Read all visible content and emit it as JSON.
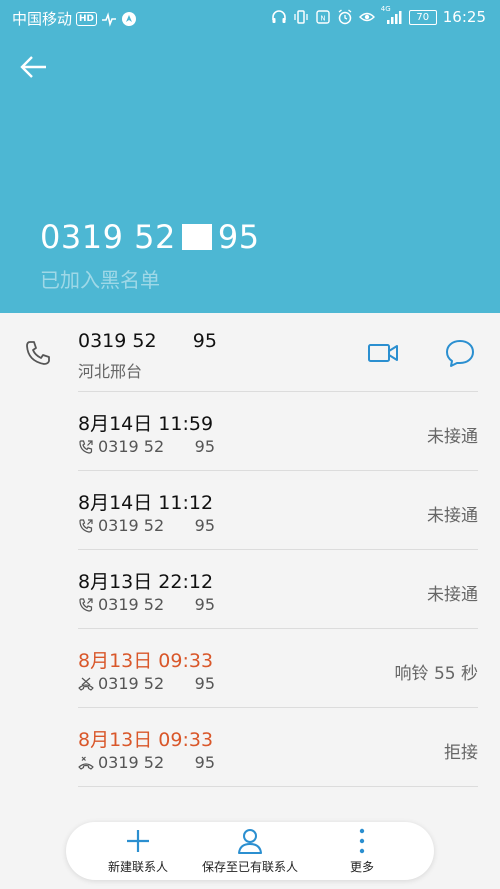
{
  "status_bar": {
    "carrier": "中国移动",
    "hd_badge": "HD",
    "network_4g": "4G",
    "battery": "70",
    "time": "16:25"
  },
  "header": {
    "number_part1": "0319 52",
    "number_part2": "95",
    "blacklist_label": "已加入黑名单"
  },
  "contact": {
    "number": "0319 52      95",
    "location": "河北邢台"
  },
  "call_log": [
    {
      "date": "8月14日 11:59",
      "number": "0319 52      95",
      "status": "未接通",
      "missed": false,
      "icon": "outgoing-call-icon"
    },
    {
      "date": "8月14日 11:12",
      "number": "0319 52      95",
      "status": "未接通",
      "missed": false,
      "icon": "outgoing-call-icon"
    },
    {
      "date": "8月13日 22:12",
      "number": "0319 52      95",
      "status": "未接通",
      "missed": false,
      "icon": "outgoing-call-icon"
    },
    {
      "date": "8月13日 09:33",
      "number": "0319 52      95",
      "status": "响铃 55 秒",
      "missed": true,
      "icon": "blocked-call-icon"
    },
    {
      "date": "8月13日 09:33",
      "number": "0319 52      95",
      "status": "拒接",
      "missed": true,
      "icon": "rejected-call-icon"
    }
  ],
  "actions": {
    "new_contact": "新建联系人",
    "save_existing": "保存至已有联系人",
    "more": "更多"
  },
  "colors": {
    "header_bg": "#4db7d3",
    "accent_blue": "#2b8fd0",
    "missed_orange": "#d9572a"
  }
}
